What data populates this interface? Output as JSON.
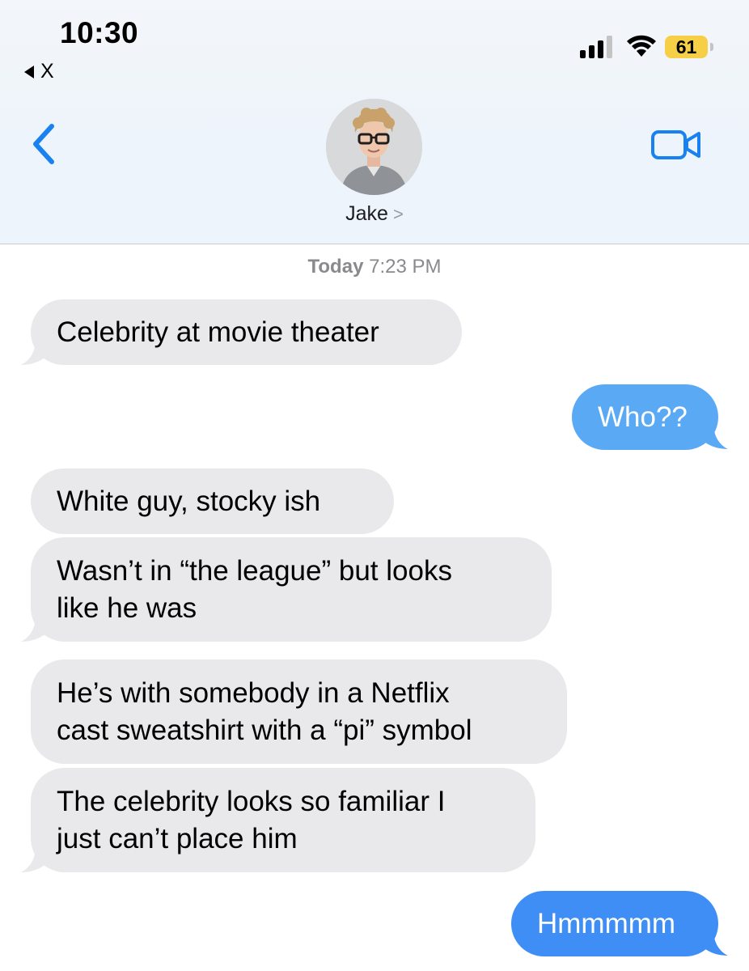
{
  "status_bar": {
    "time": "10:30",
    "back_app": "X",
    "battery": "61",
    "icons": [
      "signal-icon",
      "wifi-icon",
      "battery-icon"
    ]
  },
  "header": {
    "contact_name": "Jake",
    "contact_chevron": ">",
    "avatar_icon": "contact-photo",
    "back_icon": "chevron-left-icon",
    "video_icon": "video-camera-icon"
  },
  "conversation": {
    "timestamp_day": "Today",
    "timestamp_time": "7:23 PM",
    "messages": [
      {
        "direction": "incoming",
        "lines": [
          "Celebrity at movie theater"
        ]
      },
      {
        "direction": "outgoing",
        "lines": [
          "Who??"
        ]
      },
      {
        "direction": "incoming",
        "lines": [
          "White guy, stocky ish"
        ]
      },
      {
        "direction": "incoming",
        "lines": [
          "Wasn’t in “the league” but looks",
          "like he was"
        ]
      },
      {
        "direction": "incoming",
        "lines": [
          "He’s with somebody in a Netflix",
          "cast sweatshirt with a “pi” symbol"
        ]
      },
      {
        "direction": "incoming",
        "lines": [
          "The celebrity looks so familiar I",
          "just can’t place him"
        ]
      },
      {
        "direction": "outgoing",
        "lines": [
          "Hmmmmm"
        ]
      }
    ]
  },
  "colors": {
    "incoming_bubble": "#e9e9eb",
    "outgoing_bubble": "#5aa9f5",
    "outgoing_bubble_last": "#3f8ef5",
    "accent": "#1a82f0"
  }
}
